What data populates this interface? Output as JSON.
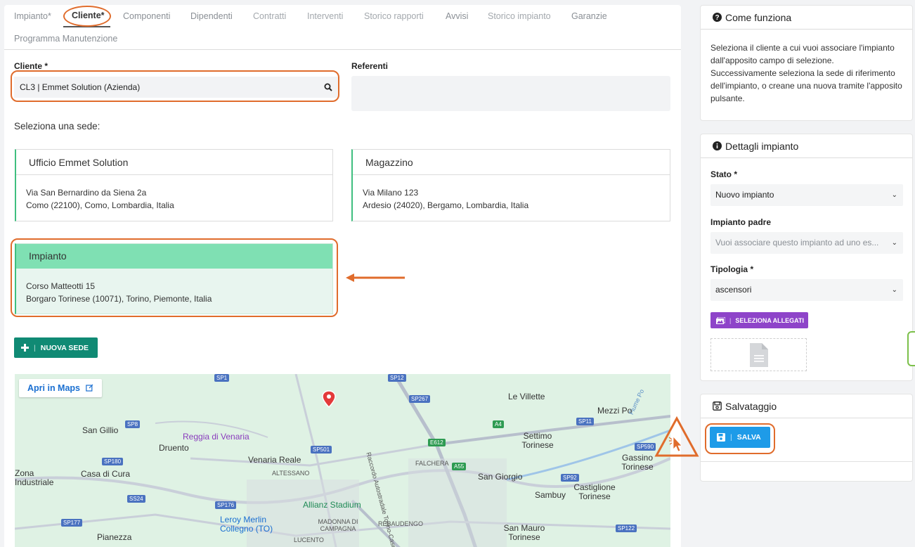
{
  "tabs": [
    {
      "label": "Impianto*"
    },
    {
      "label": "Cliente*"
    },
    {
      "label": "Componenti"
    },
    {
      "label": "Dipendenti"
    },
    {
      "label": "Contratti"
    },
    {
      "label": "Interventi"
    },
    {
      "label": "Storico rapporti"
    },
    {
      "label": "Avvisi"
    },
    {
      "label": "Storico impianto"
    },
    {
      "label": "Garanzie"
    },
    {
      "label": "Programma Manutenzione"
    }
  ],
  "cliente": {
    "label": "Cliente *",
    "value": "CL3 | Emmet Solution (Azienda)"
  },
  "referenti": {
    "label": "Referenti"
  },
  "seleziona_sede": "Seleziona una sede:",
  "sedi": [
    {
      "name": "Ufficio Emmet Solution",
      "line1": "Via San Bernardino da Siena 2a",
      "line2": "Como (22100), Como, Lombardia, Italia"
    },
    {
      "name": "Magazzino",
      "line1": "Via Milano 123",
      "line2": "Ardesio (24020), Bergamo, Lombardia, Italia"
    },
    {
      "name": "Impianto",
      "line1": "Corso Matteotti 15",
      "line2": "Borgaro Torinese (10071), Torino, Piemonte, Italia"
    }
  ],
  "nuova_sede_label": "NUOVA SEDE",
  "map": {
    "apri_label": "Apri in Maps",
    "places": [
      "Le Villette",
      "Mezzi Po",
      "San Gillio",
      "Reggia di Venaria",
      "Druento",
      "Settimo Torinese",
      "Venaria Reale",
      "Gassino Torinese",
      "Zona Industriale",
      "Casa di Cura",
      "ALTESSANO",
      "FALCHERA",
      "San Giorgio",
      "Castiglione Torinese",
      "Sambuy",
      "Allianz Stadium",
      "Leroy Merlin Collegno (TO)",
      "Pianezza",
      "MADONNA DI CAMPAGNA",
      "REBAUDENGO",
      "San Mauro Torinese",
      "LUCENTO",
      "Fiume Po",
      "Raccordo Autostradale Torino-Caselle"
    ],
    "road_shields": [
      "SP1",
      "SP12",
      "SP267",
      "SP8",
      "A4",
      "SP11",
      "E612",
      "SP590",
      "SP180",
      "SP501",
      "A55",
      "SP92",
      "SS24",
      "SP176",
      "SP177",
      "SP122"
    ]
  },
  "come_funziona": {
    "title": "Come funziona",
    "text": "Seleziona il cliente a cui vuoi associare l'impianto dall'apposito campo di selezione. Successivamente seleziona la sede di riferimento dell'impianto, o creane una nuova tramite l'apposito pulsante."
  },
  "dettagli": {
    "title": "Dettagli impianto",
    "stato_label": "Stato *",
    "stato_value": "Nuovo impianto",
    "padre_label": "Impianto padre",
    "padre_placeholder": "Vuoi associare questo impianto ad uno es...",
    "tipologia_label": "Tipologia *",
    "tipologia_value": "ascensori",
    "allegati_label": "SELEZIONA ALLEGATI"
  },
  "salvataggio": {
    "title": "Salvataggio",
    "salva_label": "SALVA"
  },
  "colors": {
    "accent_orange": "#e06c2c",
    "green": "#108a74",
    "blue": "#1e9be8",
    "purple": "#8e44c9",
    "selected_green": "#7fe0b3"
  }
}
